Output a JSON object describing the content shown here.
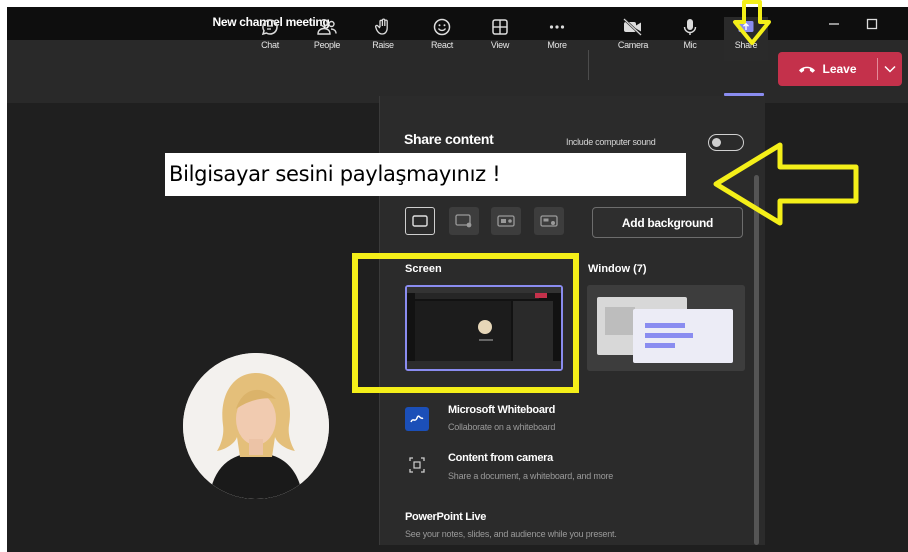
{
  "window": {
    "title": "New channel meeting"
  },
  "toolbar": {
    "items": [
      {
        "label": "Chat",
        "icon": "chat-icon"
      },
      {
        "label": "People",
        "icon": "people-icon"
      },
      {
        "label": "Raise",
        "icon": "raise-hand-icon"
      },
      {
        "label": "React",
        "icon": "react-icon"
      },
      {
        "label": "View",
        "icon": "view-icon"
      },
      {
        "label": "More",
        "icon": "more-icon"
      },
      {
        "label": "Camera",
        "icon": "camera-icon"
      },
      {
        "label": "Mic",
        "icon": "mic-icon"
      },
      {
        "label": "Share",
        "icon": "share-icon"
      }
    ],
    "leave_label": "Leave",
    "active_item": "Share"
  },
  "share_panel": {
    "title": "Share content",
    "include_sound_label": "Include computer sound",
    "include_sound_on": false,
    "add_background_label": "Add background",
    "screen_label": "Screen",
    "window_label": "Window (7)",
    "items": [
      {
        "title": "Microsoft Whiteboard",
        "subtitle": "Collaborate on a whiteboard",
        "icon": "whiteboard-icon"
      },
      {
        "title": "Content from camera",
        "subtitle": "Share a document, a whiteboard, and more",
        "icon": "camera-content-icon"
      },
      {
        "title": "PowerPoint Live",
        "subtitle": "See your notes, slides, and audience while you present."
      }
    ]
  },
  "annotation": {
    "caption": "Bilgisayar sesini paylaşmayınız !"
  },
  "colors": {
    "accent": "#8a8cf0",
    "leave": "#c4314b",
    "highlight": "#f4ef19",
    "panel": "#2b2b2b",
    "stage": "#1f1f1f"
  }
}
